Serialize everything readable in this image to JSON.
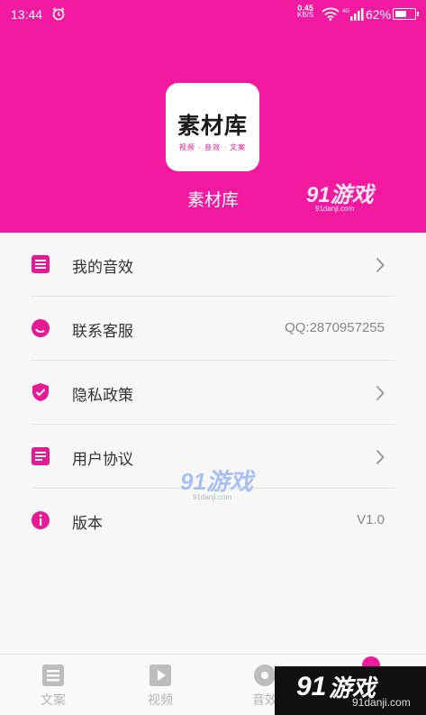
{
  "status_bar": {
    "time": "13:44",
    "net_speed": "0.45",
    "net_unit": "KB/S",
    "network_type": "4G",
    "battery": "62%",
    "battery_level": 0.62
  },
  "header": {
    "logo_title": "素材库",
    "logo_subtitle": "视频 · 音效 · 文案",
    "app_name": "素材库",
    "bg_color": "#f0199f"
  },
  "menu": {
    "items": [
      {
        "label": "我的音效",
        "icon": "audio-list-icon",
        "value": ""
      },
      {
        "label": "联系客服",
        "icon": "customer-service-icon",
        "value": "QQ:2870957255"
      },
      {
        "label": "隐私政策",
        "icon": "shield-icon",
        "value": ""
      },
      {
        "label": "用户协议",
        "icon": "document-icon",
        "value": ""
      },
      {
        "label": "版本",
        "icon": "info-icon",
        "value": "V1.0"
      }
    ]
  },
  "tab_bar": {
    "tabs": [
      {
        "label": "文案",
        "icon": "copywriting-icon"
      },
      {
        "label": "视频",
        "icon": "video-icon"
      },
      {
        "label": "音效",
        "icon": "sound-icon"
      }
    ]
  },
  "watermark": {
    "brand": "91游戏",
    "url": "91danji.com",
    "brand_short": "游戏"
  }
}
